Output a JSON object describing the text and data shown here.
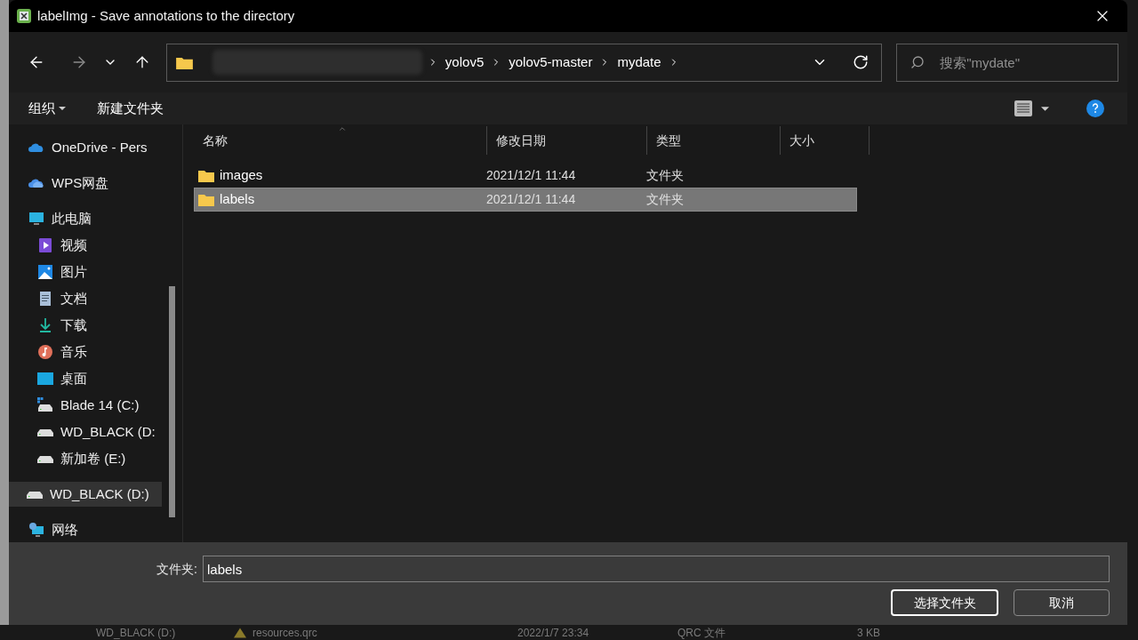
{
  "window": {
    "title": "labelImg - Save annotations to the directory"
  },
  "nav": {
    "breadcrumb": [
      "yolov5",
      "yolov5-master",
      "mydate"
    ],
    "search": {
      "placeholder": "搜索\"mydate\""
    }
  },
  "toolbar": {
    "organize": "组织",
    "new_folder": "新建文件夹"
  },
  "sidebar": {
    "items": [
      {
        "label": "OneDrive - Pers",
        "kind": "onedrive",
        "selected": false
      },
      {
        "label": "WPS网盘",
        "kind": "cloud",
        "selected": false
      },
      {
        "label": "此电脑",
        "kind": "computer",
        "selected": false,
        "children": [
          {
            "label": "视频",
            "kind": "video",
            "selected": false
          },
          {
            "label": "图片",
            "kind": "pictures",
            "selected": false
          },
          {
            "label": "文档",
            "kind": "document",
            "selected": false
          },
          {
            "label": "下载",
            "kind": "download",
            "selected": false
          },
          {
            "label": "音乐",
            "kind": "music",
            "selected": false
          },
          {
            "label": "桌面",
            "kind": "desktop",
            "selected": false
          },
          {
            "label": "Blade 14 (C:)",
            "kind": "system-drive",
            "selected": false
          },
          {
            "label": "WD_BLACK (D:",
            "kind": "drive",
            "selected": false
          },
          {
            "label": "新加卷 (E:)",
            "kind": "drive",
            "selected": false
          }
        ]
      },
      {
        "label": "WD_BLACK (D:)",
        "kind": "drive",
        "selected": true
      },
      {
        "label": "网络",
        "kind": "network",
        "selected": false
      }
    ]
  },
  "table": {
    "columns": [
      "名称",
      "修改日期",
      "类型",
      "大小"
    ],
    "rows": [
      {
        "name": "images",
        "modified": "2021/12/1 11:44",
        "type": "文件夹",
        "selected": false
      },
      {
        "name": "labels",
        "modified": "2021/12/1 11:44",
        "type": "文件夹",
        "selected": true
      }
    ]
  },
  "footer": {
    "folder_label": "文件夹:",
    "folder_value": "labels",
    "buttons": [
      "选择文件夹",
      "取消"
    ]
  },
  "background_row": {
    "drive": "WD_BLACK (D:)",
    "file": "resources.qrc",
    "modified": "2022/1/7 23:34",
    "type": "QRC 文件",
    "size": "3 KB"
  }
}
